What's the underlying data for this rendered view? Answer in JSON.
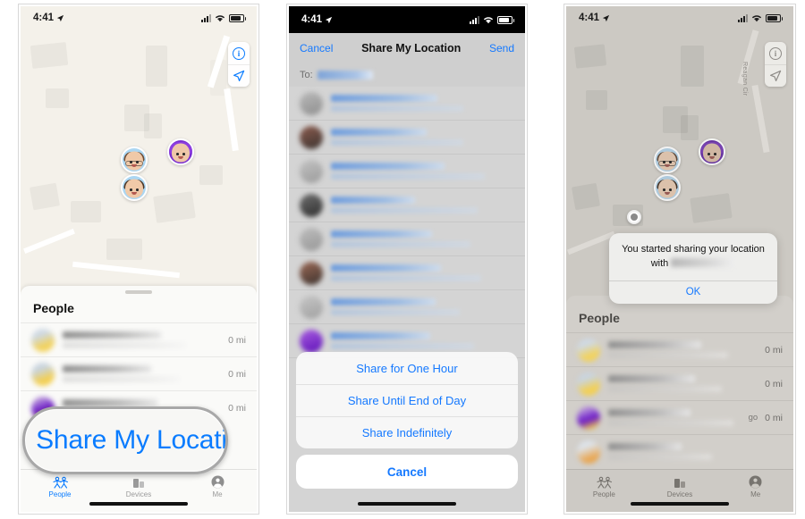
{
  "panels": [
    {
      "id": "panel-find-my-people",
      "status": {
        "time": "4:41",
        "location_arrow": "location-arrow-icon",
        "signal": "cellular-signal-icon",
        "wifi": "wifi-icon",
        "battery": "battery-icon"
      },
      "map_controls": {
        "info": "info-circle-icon",
        "locate": "locate-arrow-icon"
      },
      "sheet": {
        "title": "People"
      },
      "rows": [
        {
          "distance": "0 mi"
        },
        {
          "distance": "0 mi"
        },
        {
          "distance": "0 mi"
        }
      ],
      "tabs": [
        {
          "label": "People",
          "icon": "people-icon",
          "active": true
        },
        {
          "label": "Devices",
          "icon": "devices-icon",
          "active": false
        },
        {
          "label": "Me",
          "icon": "person-circle-icon",
          "active": false
        }
      ],
      "callout": {
        "text": "Share My Locati"
      }
    },
    {
      "id": "panel-share-compose",
      "status": {
        "time": "4:41"
      },
      "nav": {
        "cancel": "Cancel",
        "title": "Share My Location",
        "send": "Send"
      },
      "to_field": {
        "label": "To:",
        "value": ""
      },
      "action_sheet": {
        "options": [
          "Share for One Hour",
          "Share Until End of Day",
          "Share Indefinitely"
        ],
        "cancel": "Cancel"
      }
    },
    {
      "id": "panel-share-confirmed",
      "status": {
        "time": "4:41"
      },
      "map_controls": {
        "info": "info-circle-icon",
        "locate": "locate-arrow-icon"
      },
      "road_label": "Reagan Cir",
      "alert": {
        "message_before": "You started sharing your location with",
        "ok": "OK"
      },
      "sheet": {
        "title": "People"
      },
      "rows": [
        {
          "distance": "0 mi",
          "note": ""
        },
        {
          "distance": "0 mi",
          "note": ""
        },
        {
          "distance": "0 mi",
          "note": "go"
        },
        {
          "distance": "",
          "note": ""
        }
      ],
      "tabs": [
        {
          "label": "People",
          "icon": "people-icon",
          "active": false
        },
        {
          "label": "Devices",
          "icon": "devices-icon",
          "active": false
        },
        {
          "label": "Me",
          "icon": "person-circle-icon",
          "active": false
        }
      ]
    }
  ],
  "colors": {
    "accent_blue": "#0a7cff",
    "sheet_blue": "#1579ff",
    "map_light": "#f4f1ea",
    "map_dim": "#ccc9c3",
    "gray_text": "#8b8b8b"
  }
}
